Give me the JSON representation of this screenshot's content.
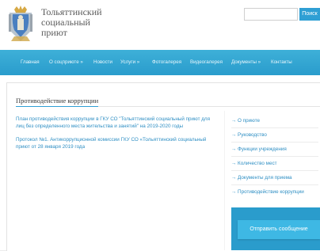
{
  "header": {
    "title_lines": [
      "Тольяттинский",
      "социальный",
      "приют"
    ],
    "search_placeholder": "",
    "search_button": "Поиск"
  },
  "nav": {
    "items": [
      {
        "label": "Главная"
      },
      {
        "label": "О соцприюте »"
      },
      {
        "label": "Новости"
      },
      {
        "label": "Услуги »"
      },
      {
        "label": "Фотогалерея"
      },
      {
        "label": "Видеогалерея"
      },
      {
        "label": "Документы »"
      },
      {
        "label": "Контакты"
      }
    ]
  },
  "main": {
    "title": "Противодействие коррупции",
    "documents": [
      {
        "text": "План противодействия коррупции в ГКУ СО \"Тольяттинский социальный приют для лиц без определенного места жительства и занятий\" на 2019-2020 годы"
      },
      {
        "text": "Протокол №1. Антикоррупционной комиссии ГКУ СО «Тольяттинский социальный приют от 28 января 2019 года"
      }
    ]
  },
  "sidebar": {
    "items": [
      {
        "label": "→ О приюте"
      },
      {
        "label": "→ Руководство"
      },
      {
        "label": "→ Функции учреждения"
      },
      {
        "label": "→ Количество мест"
      },
      {
        "label": "→ Документы для приема"
      },
      {
        "label": "→ Противодействие коррупции"
      }
    ],
    "feedback_button": "Отправить сообщение"
  },
  "colors": {
    "accent": "#2f9fd4",
    "nav_bg": "#2a9ccc",
    "link": "#2f8fc4"
  }
}
